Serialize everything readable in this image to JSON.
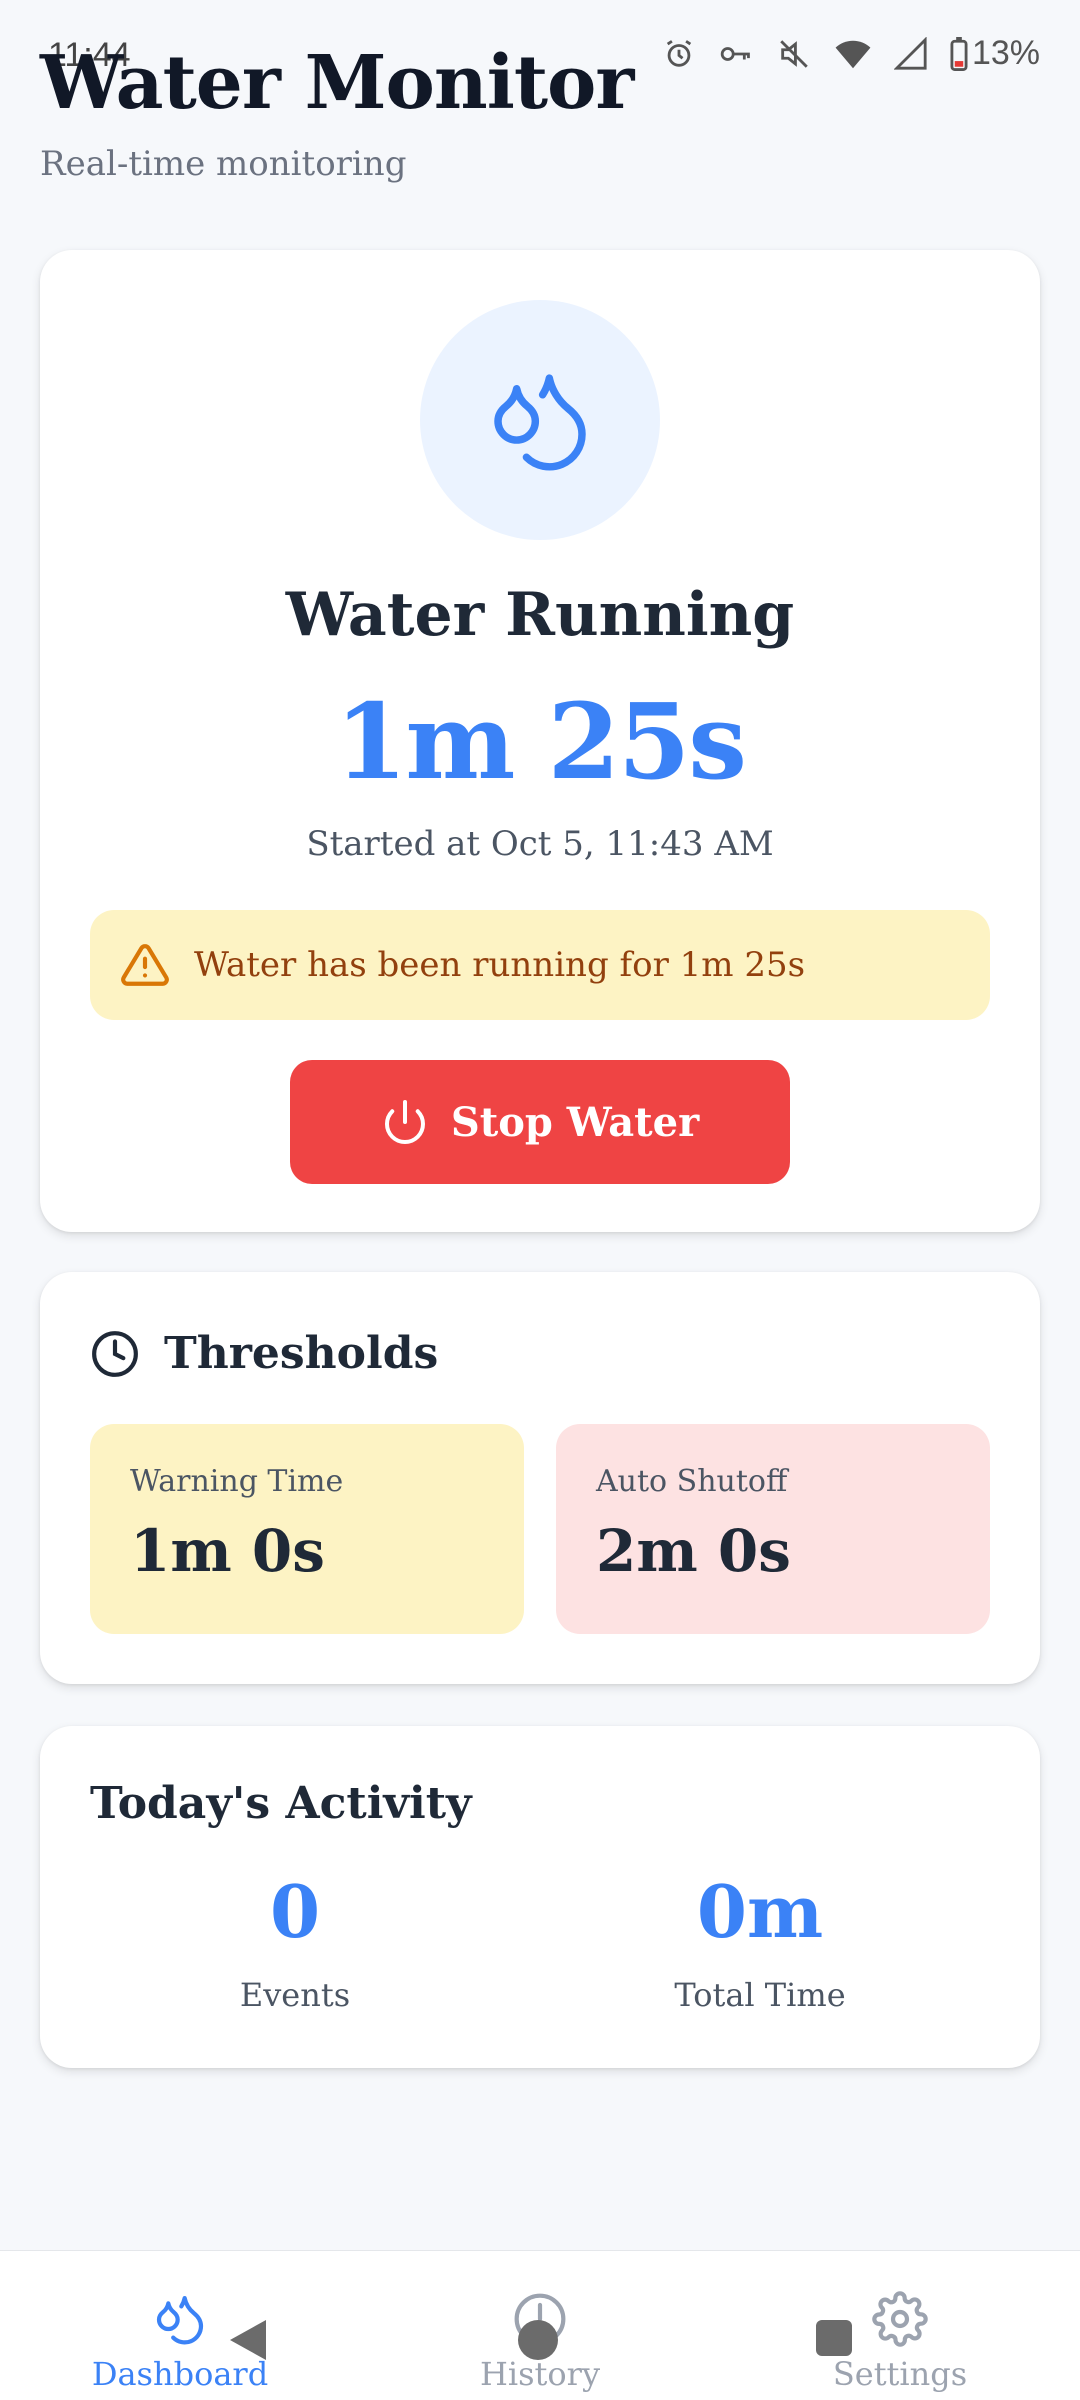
{
  "status_bar": {
    "time": "11:44",
    "battery": "13%"
  },
  "header": {
    "title": "Water Monitor",
    "subtitle": "Real-time monitoring"
  },
  "status_card": {
    "icon": "water-drops-icon",
    "title": "Water Running",
    "timer": "1m 25s",
    "started": "Started at Oct 5, 11:43 AM",
    "warning": "Water has been running for 1m 25s",
    "stop_button": "Stop Water"
  },
  "thresholds": {
    "title": "Thresholds",
    "warning_label": "Warning Time",
    "warning_value": "1m 0s",
    "shutoff_label": "Auto Shutoff",
    "shutoff_value": "2m 0s"
  },
  "activity": {
    "title": "Today's Activity",
    "events_value": "0",
    "events_label": "Events",
    "total_value": "0m",
    "total_label": "Total Time"
  },
  "nav": {
    "dashboard": "Dashboard",
    "history": "History",
    "settings": "Settings"
  },
  "colors": {
    "accent": "#3b82f6",
    "danger": "#ef4444",
    "warning_bg": "#fdf3c4",
    "shutoff_bg": "#fde2e2"
  }
}
